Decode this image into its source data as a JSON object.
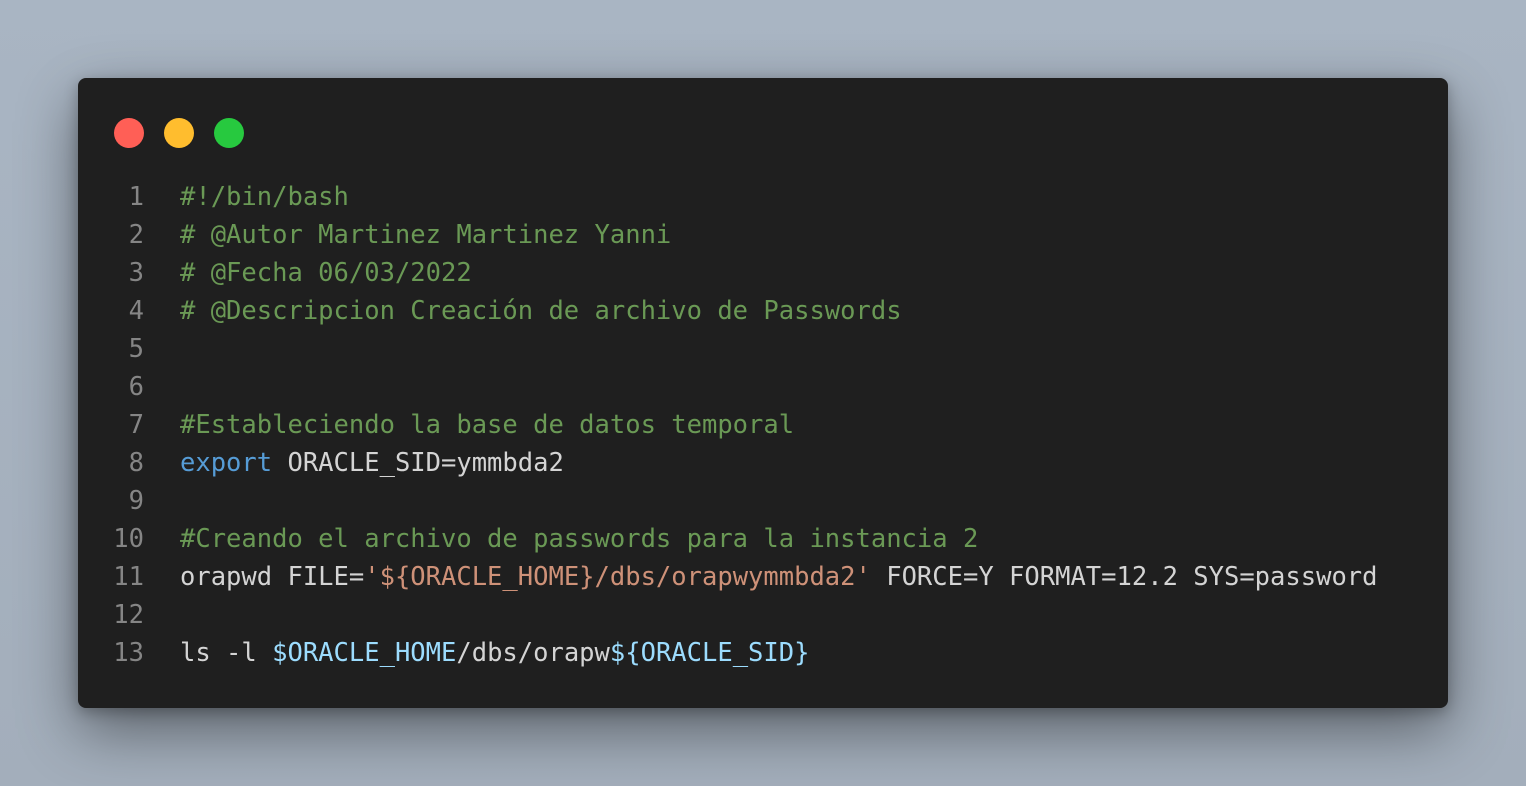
{
  "window": {
    "controls": [
      {
        "name": "close",
        "color": "#ff5f56"
      },
      {
        "name": "minimize",
        "color": "#ffbd2e"
      },
      {
        "name": "zoom",
        "color": "#27c93f"
      }
    ]
  },
  "colors": {
    "background": "#a9b5c3",
    "editor": "#1f1f1f",
    "line_number": "#858585",
    "comment": "#6a9955",
    "keyword": "#569cd6",
    "string": "#ce9178",
    "variable": "#9cdcfe",
    "plain": "#d4d4d4"
  },
  "code": {
    "lines": [
      {
        "number": "1",
        "tokens": [
          {
            "type": "comment",
            "text": "#!/bin/bash"
          }
        ]
      },
      {
        "number": "2",
        "tokens": [
          {
            "type": "comment",
            "text": "# @Autor Martinez Martinez Yanni"
          }
        ]
      },
      {
        "number": "3",
        "tokens": [
          {
            "type": "comment",
            "text": "# @Fecha 06/03/2022"
          }
        ]
      },
      {
        "number": "4",
        "tokens": [
          {
            "type": "comment",
            "text": "# @Descripcion Creación de archivo de Passwords"
          }
        ]
      },
      {
        "number": "5",
        "tokens": []
      },
      {
        "number": "6",
        "tokens": []
      },
      {
        "number": "7",
        "tokens": [
          {
            "type": "comment",
            "text": "#Estableciendo la base de datos temporal"
          }
        ]
      },
      {
        "number": "8",
        "tokens": [
          {
            "type": "keyword",
            "text": "export"
          },
          {
            "type": "plain",
            "text": " ORACLE_SID=ymmbda2"
          }
        ]
      },
      {
        "number": "9",
        "tokens": []
      },
      {
        "number": "10",
        "tokens": [
          {
            "type": "comment",
            "text": "#Creando el archivo de passwords para la instancia 2"
          }
        ]
      },
      {
        "number": "11",
        "tokens": [
          {
            "type": "plain",
            "text": "orapwd FILE="
          },
          {
            "type": "string",
            "text": "'${ORACLE_HOME}/dbs/orapwymmbda2'"
          },
          {
            "type": "plain",
            "text": " FORCE=Y FORMAT=12.2 SYS=password"
          }
        ]
      },
      {
        "number": "12",
        "tokens": []
      },
      {
        "number": "13",
        "tokens": [
          {
            "type": "plain",
            "text": "ls -l "
          },
          {
            "type": "var",
            "text": "$ORACLE_HOME"
          },
          {
            "type": "plain",
            "text": "/dbs/orapw"
          },
          {
            "type": "var",
            "text": "${ORACLE_SID}"
          }
        ]
      }
    ]
  }
}
